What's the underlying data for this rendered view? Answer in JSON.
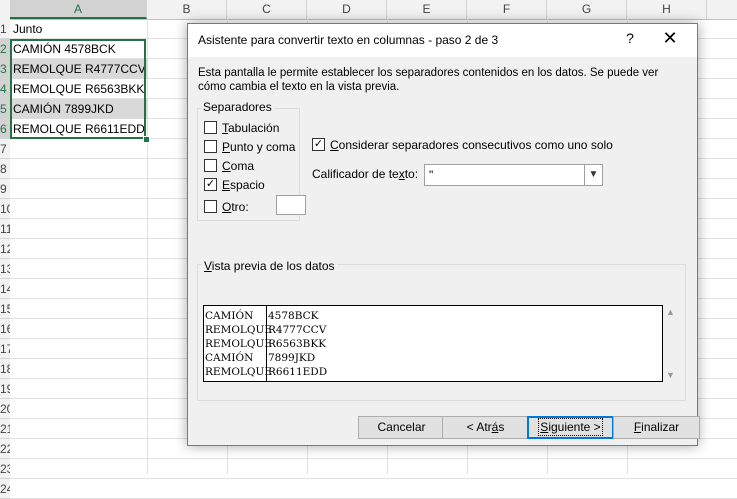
{
  "spreadsheet": {
    "columns": [
      "A",
      "B",
      "C",
      "D",
      "E",
      "F",
      "G",
      "H"
    ],
    "selected_column": "A",
    "rows": [
      "1",
      "2",
      "3",
      "4",
      "5",
      "6",
      "7",
      "8",
      "9",
      "10",
      "11",
      "12",
      "13",
      "14",
      "15",
      "16",
      "17",
      "18",
      "19",
      "20",
      "21",
      "22",
      "23",
      "24"
    ],
    "cells": [
      "Junto",
      "CAMIÓN 4578BCK",
      "REMOLQUE R4777CCV",
      "REMOLQUE R6563BKK",
      "CAMIÓN 7899JKD",
      "REMOLQUE R6611EDD"
    ],
    "colors": {
      "accent": "#217346",
      "selection_fill": "#d9d9d9"
    }
  },
  "dialog": {
    "title": "Asistente para convertir texto en columnas - paso 2 de 3",
    "help_glyph": "?",
    "close_glyph": "✕",
    "description": "Esta pantalla le permite establecer los separadores contenidos en los datos. Se puede ver cómo cambia el texto en la vista previa.",
    "separators": {
      "legend": "Separadores",
      "options": [
        {
          "pre": "",
          "accel": "T",
          "post": "abulación",
          "checked": false
        },
        {
          "pre": "",
          "accel": "P",
          "post": "unto y coma",
          "checked": false
        },
        {
          "pre": "",
          "accel": "C",
          "post": "oma",
          "checked": false
        },
        {
          "pre": "",
          "accel": "E",
          "post": "spacio",
          "checked": true
        },
        {
          "pre": "",
          "accel": "O",
          "post": "tro:",
          "checked": false
        }
      ],
      "other_value": ""
    },
    "consecutive": {
      "pre": "",
      "accel": "C",
      "post": "onsiderar separadores consecutivos como uno solo",
      "checked": true
    },
    "qualifier": {
      "label_pre": "Calificador de te",
      "accel": "x",
      "label_post": "to:",
      "value": "\""
    },
    "preview": {
      "legend_accel": "V",
      "legend_rest": "ista previa de los datos",
      "rows": [
        [
          "CAMIÓN",
          "4578BCK"
        ],
        [
          "REMOLQUE",
          "R4777CCV"
        ],
        [
          "REMOLQUE",
          "R6563BKK"
        ],
        [
          "CAMIÓN",
          "7899JKD"
        ],
        [
          "REMOLQUE",
          "R6611EDD"
        ]
      ]
    },
    "buttons": {
      "cancel": "Cancelar",
      "back": {
        "pre": "< Atr",
        "accel": "á",
        "post": "s"
      },
      "next": {
        "pre": "",
        "accel": "S",
        "post": "iguiente >"
      },
      "finish": {
        "pre": "",
        "accel": "F",
        "post": "inalizar"
      }
    }
  }
}
